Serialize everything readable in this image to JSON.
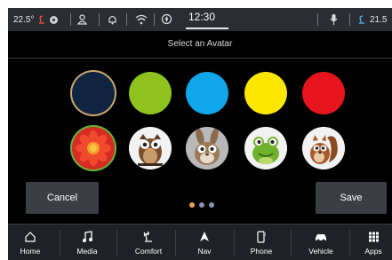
{
  "status": {
    "temp_left": "22.5°",
    "time": "12:30",
    "temp_right": "21.5"
  },
  "title": "Select an Avatar",
  "avatars": {
    "row1": [
      {
        "name": "navy",
        "color": "#0f2440"
      },
      {
        "name": "green",
        "color": "#8dc21f"
      },
      {
        "name": "blue",
        "color": "#10a6ea"
      },
      {
        "name": "yellow",
        "color": "#fde600"
      },
      {
        "name": "red",
        "color": "#e6141c"
      }
    ],
    "row2": [
      "flower",
      "owl",
      "rabbit",
      "frog",
      "squirrel"
    ]
  },
  "buttons": {
    "cancel": "Cancel",
    "save": "Save"
  },
  "pagination": {
    "pages": 3,
    "active": 1
  },
  "nav": [
    {
      "label": "Home",
      "icon": "home-icon"
    },
    {
      "label": "Media",
      "icon": "music-note-icon"
    },
    {
      "label": "Comfort",
      "icon": "seat-heat-icon"
    },
    {
      "label": "Nav",
      "icon": "navigation-arrow-icon"
    },
    {
      "label": "Phone",
      "icon": "phone-icon"
    },
    {
      "label": "Vehicle",
      "icon": "car-icon"
    },
    {
      "label": "Apps",
      "icon": "apps-grid-icon"
    }
  ],
  "colors": {
    "accent": "#c9a86a",
    "button": "#3b3f45"
  }
}
